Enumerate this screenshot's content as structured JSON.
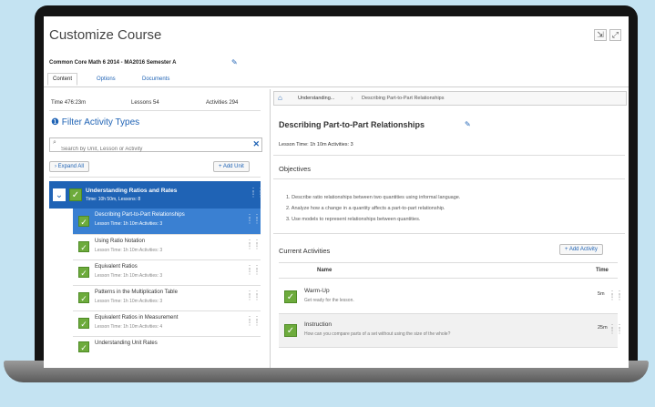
{
  "page": {
    "title": "Customize Course",
    "subtitle": "Common Core Math 6 2014 - MA2016 Semester A"
  },
  "tabs": [
    {
      "label": "Content"
    },
    {
      "label": "Options"
    },
    {
      "label": "Documents"
    }
  ],
  "summary": {
    "time": "Time  476:23m",
    "lessons": "Lessons  54",
    "activities": "Activities  294"
  },
  "filter": {
    "label": "Filter Activity Types",
    "search_placeholder": "Search by Unit, Lesson or Activity",
    "expand_all": "Expand All",
    "add_unit": "+ Add Unit"
  },
  "unit": {
    "title": "Understanding Ratios and Rates",
    "meta": "Time: 10h 50m, Lessons: 8"
  },
  "lessons": [
    {
      "title": "Describing Part-to-Part Relationships",
      "meta": "Lesson Time: 1h 10m  Activities: 3",
      "selected": true
    },
    {
      "title": "Using Ratio Notation",
      "meta": "Lesson Time: 1h 10m  Activities: 3",
      "selected": false
    },
    {
      "title": "Equivalent Ratios",
      "meta": "Lesson Time: 1h 10m  Activities: 3",
      "selected": false
    },
    {
      "title": "Patterns in the Multiplication Table",
      "meta": "Lesson Time: 1h 10m  Activities: 3",
      "selected": false
    },
    {
      "title": "Equivalent Ratios in Measurement",
      "meta": "Lesson Time: 1h 10m  Activities: 4",
      "selected": false
    },
    {
      "title": "Understanding Unit Rates",
      "meta": "",
      "selected": false
    }
  ],
  "breadcrumb": {
    "parent": "Understanding...",
    "current": "Describing Part-to-Part Relationships"
  },
  "detail": {
    "heading": "Describing Part-to-Part Relationships",
    "meta": "Lesson Time: 1h 10m   Activities: 3",
    "objectives_label": "Objectives",
    "objectives": [
      "1.  Describe ratio relationships between two quantities using informal language.",
      "2.  Analyze how a change in a quantity affects a part-to-part relationship.",
      "3.  Use models to represent relationships between quantities."
    ],
    "current_label": "Current Activities",
    "add_activity": "+ Add Activity",
    "col_name": "Name",
    "col_time": "Time"
  },
  "activities": [
    {
      "name": "Warm-Up",
      "desc": "Get ready for the lesson.",
      "time": "5m"
    },
    {
      "name": "Instruction",
      "desc": "How can you compare parts of a set without using the size of the whole?",
      "time": "25m"
    }
  ]
}
